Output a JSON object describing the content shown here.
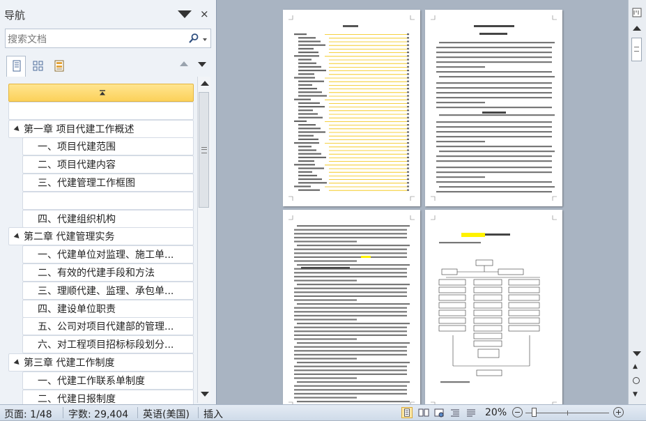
{
  "nav": {
    "title": "导航",
    "close_glyph": "×",
    "search_placeholder": "搜索文档",
    "tabs": [
      "headings-view",
      "pages-view",
      "results-view"
    ],
    "tree": [
      {
        "level": 1,
        "label": "",
        "selected": true
      },
      {
        "level": 1,
        "label": ""
      },
      {
        "level": 1,
        "label": "第一章  项目代建工作概述",
        "expanded": true
      },
      {
        "level": 2,
        "label": "一、项目代建范围"
      },
      {
        "level": 2,
        "label": "二、项目代建内容"
      },
      {
        "level": 2,
        "label": "三、代建管理工作框图"
      },
      {
        "level": 2,
        "label": ""
      },
      {
        "level": 2,
        "label": "四、代建组织机构"
      },
      {
        "level": 1,
        "label": "第二章 代建管理实务",
        "expanded": true
      },
      {
        "level": 2,
        "label": "一、代建单位对监理、施工单..."
      },
      {
        "level": 2,
        "label": "二、有效的代建手段和方法"
      },
      {
        "level": 2,
        "label": "三、理顺代建、监理、承包单..."
      },
      {
        "level": 2,
        "label": "四、建设单位职责"
      },
      {
        "level": 2,
        "label": "五、公司对项目代建部的管理..."
      },
      {
        "level": 2,
        "label": "六、对工程项目招标标段划分..."
      },
      {
        "level": 1,
        "label": "第三章  代建工作制度",
        "expanded": true
      },
      {
        "level": 2,
        "label": "一、代建工作联系单制度"
      },
      {
        "level": 2,
        "label": "二、代建日报制度"
      }
    ]
  },
  "document": {
    "pages_visible": 4,
    "highlight_color": "#fff200",
    "toc_leader_color": "#f2c200"
  },
  "statusbar": {
    "page": "页面: 1/48",
    "words": "字数: 29,404",
    "language": "英语(美国)",
    "mode": "插入",
    "zoom": "20%",
    "zoom_percent": 20
  },
  "icons": {
    "search": "magnifier-icon",
    "close": "close-icon",
    "menu": "chevron-down-icon"
  }
}
